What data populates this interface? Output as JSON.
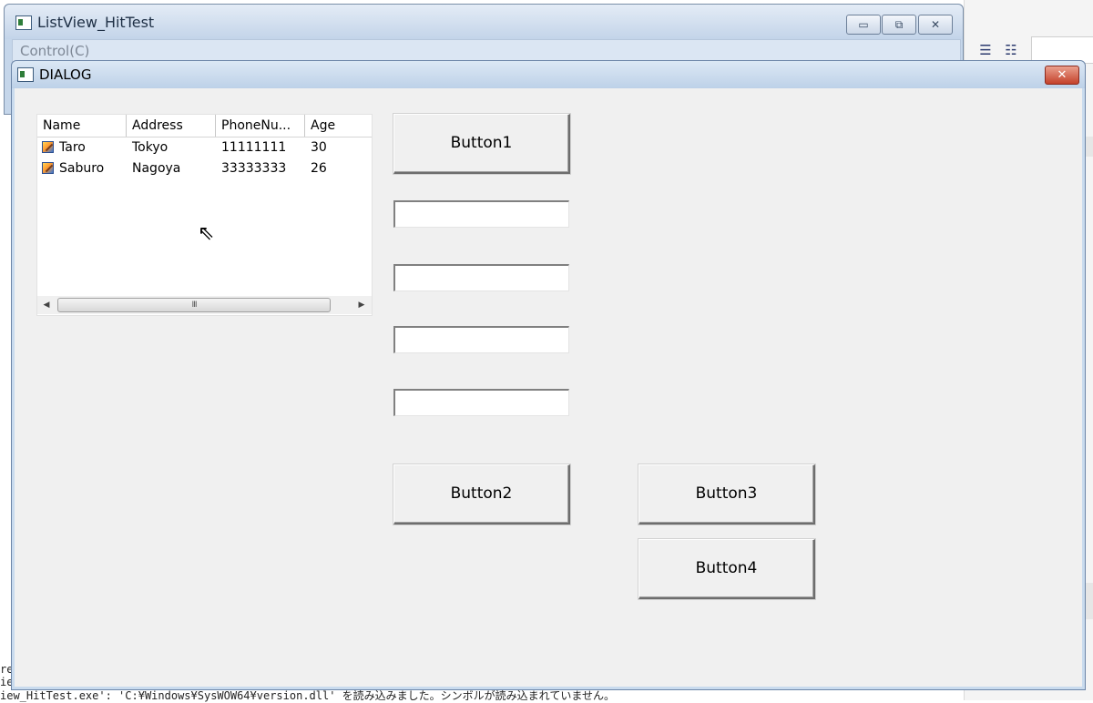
{
  "background_app": {
    "title": "ListView_HitTest",
    "menu": [
      "Control(C)"
    ],
    "controls": {
      "minimize": "▭",
      "maximize": "⧉",
      "close": "✕"
    }
  },
  "dialog": {
    "title": "DIALOG",
    "close_label": "✕",
    "listview": {
      "columns": [
        "Name",
        "Address",
        "PhoneNu...",
        "Age"
      ],
      "rows": [
        {
          "name": "Taro",
          "address": "Tokyo",
          "phone": "11111111",
          "age": "30"
        },
        {
          "name": "Saburo",
          "address": "Nagoya",
          "phone": "33333333",
          "age": "26"
        }
      ],
      "scroll_thumb_label": "III"
    },
    "buttons": {
      "button1": "Button1",
      "button2": "Button2",
      "button3": "Button3",
      "button4": "Button4"
    },
    "edits": [
      "",
      "",
      "",
      ""
    ]
  },
  "status_text": {
    "line1": "re",
    "line2": "ie",
    "line3": "iew_HitTest.exe': 'C:¥Windows¥SysWOW64¥version.dll' を読み込みました。シンボルが読み込まれていません。"
  },
  "icons": {
    "list_item_icon": "edit-pencil-icon",
    "window_icon": "app-window-icon",
    "cursor": "mouse-pointer-icon"
  },
  "colors": {
    "titlebar": "#c3d4e9",
    "close_button": "#c4422b",
    "dialog_bg": "#f0f0f0"
  }
}
